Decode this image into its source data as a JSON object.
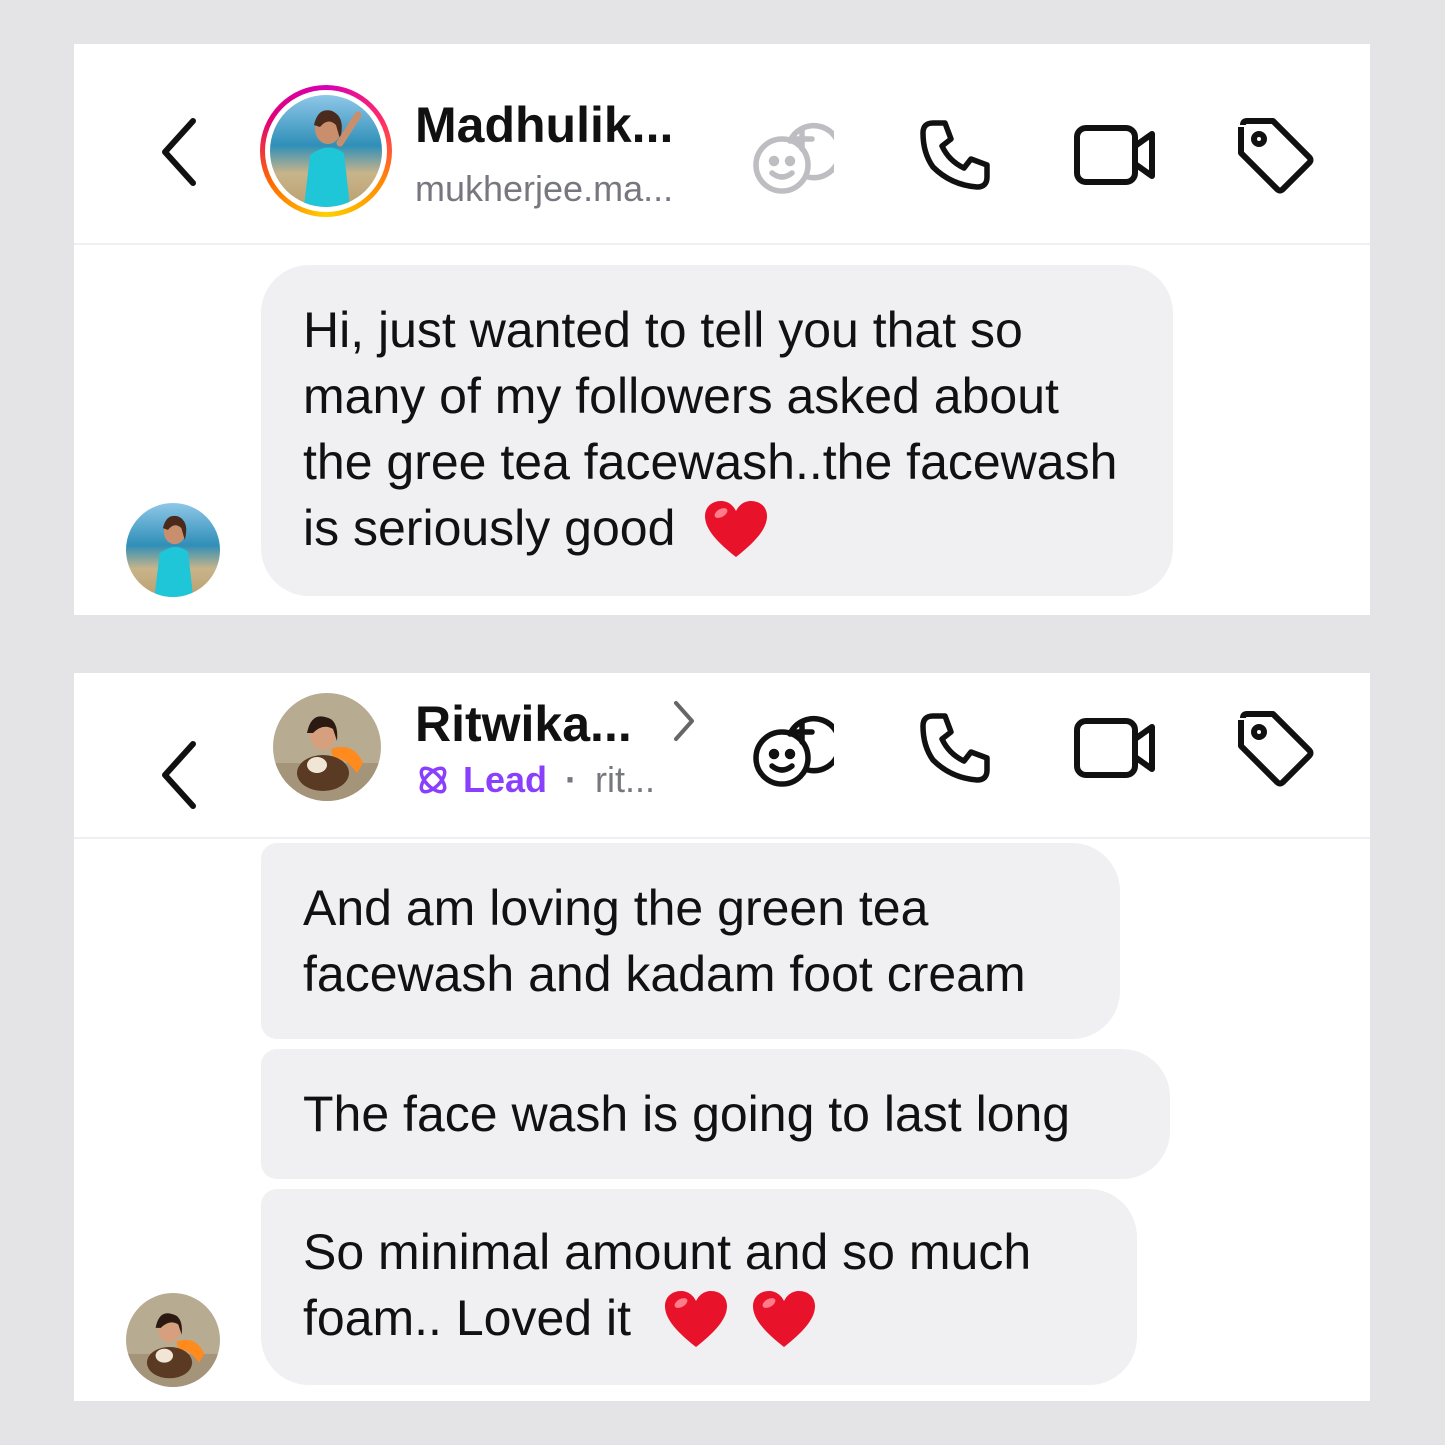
{
  "conversations": [
    {
      "header": {
        "name": "Madhulik...",
        "subtitle": "mukherjee.ma..."
      },
      "messages": [
        {
          "text": "Hi, just wanted to tell you that so many of my followers asked about the gree tea facewash..the facewash is seriously good",
          "hearts": 1
        }
      ]
    },
    {
      "header": {
        "name": "Ritwika...",
        "lead_label": "Lead",
        "separator": "·",
        "subtitle": "rit..."
      },
      "messages": [
        {
          "text": "And am loving the green tea facewash and kadam foot cream",
          "hearts": 0
        },
        {
          "text": "The face wash is going to last long",
          "hearts": 0
        },
        {
          "text": "So minimal amount and so much foam.. Loved it",
          "hearts": 2
        }
      ]
    }
  ],
  "icons": {
    "back": "chevron-left-icon",
    "add_sticker": "face-plus-icon",
    "call": "phone-icon",
    "video": "video-camera-icon",
    "label": "tag-icon",
    "reaction": "red-heart-emoji"
  },
  "colors": {
    "lead_accent": "#8a3ffc",
    "bubble_bg": "#f0f0f3",
    "heart": "#e8122a"
  }
}
